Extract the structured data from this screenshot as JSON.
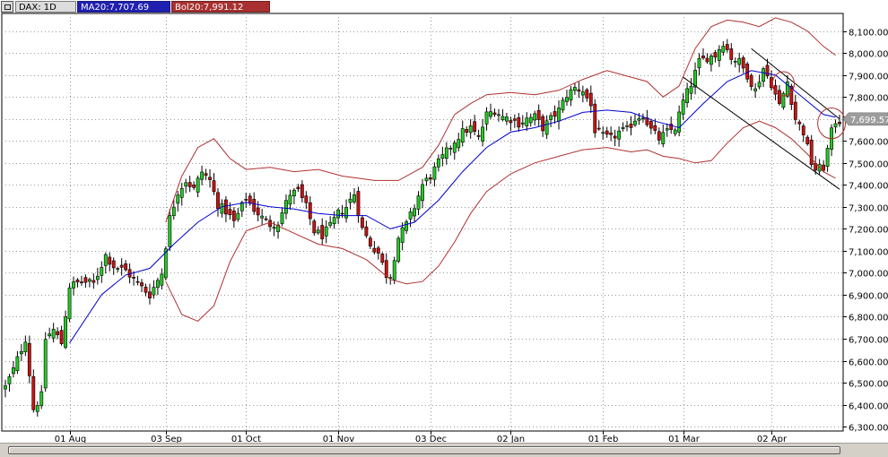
{
  "legend": {
    "symbol": "DAX: 1D",
    "ma": "MA20:7,707.69",
    "bol": "Bol20:7,991.12"
  },
  "colors": {
    "up_candle": "#22cc22",
    "down_candle": "#cc1111",
    "ma_line": "#0000cc",
    "bollinger": "#b03030",
    "trendline": "#000000",
    "grid": "#999999",
    "price_tag_bg": "#9c9c9c"
  },
  "chart_data": {
    "type": "candlestick",
    "title": "",
    "instrument": "DAX: 1D",
    "ylim": [
      6280,
      8180
    ],
    "y_ticks": [
      6300,
      6400,
      6500,
      6600,
      6700,
      6800,
      6900,
      7000,
      7100,
      7200,
      7300,
      7400,
      7500,
      7600,
      7700,
      7800,
      7900,
      8000,
      8100
    ],
    "y_tick_labels": [
      "6,300.00",
      "6,400.00",
      "6,500.00",
      "6,600.00",
      "6,700.00",
      "6,800.00",
      "6,900.00",
      "7,000.00",
      "7,100.00",
      "7,200.00",
      "7,300.00",
      "7,400.00",
      "7,500.00",
      "7,600.00",
      "7,700.00",
      "7,800.00",
      "7,900.00",
      "8,000.00",
      "8,100.00"
    ],
    "x_labels": [
      {
        "label": "01 Aug",
        "index": 16
      },
      {
        "label": "03 Sep",
        "index": 40
      },
      {
        "label": "01 Oct",
        "index": 60
      },
      {
        "label": "01 Nov",
        "index": 83
      },
      {
        "label": "03 Dec",
        "index": 106
      },
      {
        "label": "02 Jan",
        "index": 126
      },
      {
        "label": "01 Feb",
        "index": 149
      },
      {
        "label": "01 Mar",
        "index": 169
      },
      {
        "label": "02 Apr",
        "index": 191
      }
    ],
    "last_price": 7699.57,
    "last_price_label": "7,699.57",
    "grid": true,
    "anchors": [
      [
        0,
        6480
      ],
      [
        2,
        6560
      ],
      [
        5,
        6700
      ],
      [
        7,
        6380
      ],
      [
        9,
        6440
      ],
      [
        10,
        6700
      ],
      [
        12,
        6740
      ],
      [
        14,
        6680
      ],
      [
        16,
        6940
      ],
      [
        19,
        6960
      ],
      [
        22,
        6950
      ],
      [
        25,
        7080
      ],
      [
        27,
        7030
      ],
      [
        30,
        7010
      ],
      [
        33,
        6950
      ],
      [
        36,
        6900
      ],
      [
        39,
        7000
      ],
      [
        41,
        7250
      ],
      [
        43,
        7370
      ],
      [
        45,
        7420
      ],
      [
        47,
        7380
      ],
      [
        49,
        7460
      ],
      [
        51,
        7420
      ],
      [
        53,
        7310
      ],
      [
        55,
        7280
      ],
      [
        57,
        7230
      ],
      [
        60,
        7340
      ],
      [
        62,
        7290
      ],
      [
        64,
        7250
      ],
      [
        66,
        7220
      ],
      [
        68,
        7230
      ],
      [
        71,
        7360
      ],
      [
        73,
        7370
      ],
      [
        75,
        7300
      ],
      [
        77,
        7190
      ],
      [
        79,
        7170
      ],
      [
        81,
        7210
      ],
      [
        83,
        7270
      ],
      [
        85,
        7300
      ],
      [
        87,
        7360
      ],
      [
        89,
        7200
      ],
      [
        91,
        7130
      ],
      [
        93,
        7090
      ],
      [
        95,
        6990
      ],
      [
        96,
        6990
      ],
      [
        98,
        7160
      ],
      [
        100,
        7220
      ],
      [
        102,
        7300
      ],
      [
        104,
        7400
      ],
      [
        106,
        7440
      ],
      [
        108,
        7500
      ],
      [
        110,
        7550
      ],
      [
        112,
        7600
      ],
      [
        114,
        7640
      ],
      [
        116,
        7660
      ],
      [
        118,
        7610
      ],
      [
        120,
        7720
      ],
      [
        122,
        7740
      ],
      [
        124,
        7710
      ],
      [
        126,
        7700
      ],
      [
        128,
        7680
      ],
      [
        130,
        7700
      ],
      [
        132,
        7710
      ],
      [
        134,
        7660
      ],
      [
        136,
        7700
      ],
      [
        138,
        7740
      ],
      [
        140,
        7810
      ],
      [
        142,
        7840
      ],
      [
        144,
        7830
      ],
      [
        146,
        7760
      ],
      [
        147,
        7650
      ],
      [
        149,
        7620
      ],
      [
        151,
        7610
      ],
      [
        153,
        7640
      ],
      [
        155,
        7650
      ],
      [
        157,
        7700
      ],
      [
        159,
        7720
      ],
      [
        161,
        7650
      ],
      [
        163,
        7610
      ],
      [
        165,
        7640
      ],
      [
        167,
        7660
      ],
      [
        169,
        7780
      ],
      [
        171,
        7860
      ],
      [
        173,
        7960
      ],
      [
        175,
        7980
      ],
      [
        177,
        7990
      ],
      [
        179,
        8050
      ],
      [
        181,
        7980
      ],
      [
        183,
        7960
      ],
      [
        185,
        7900
      ],
      [
        187,
        7830
      ],
      [
        189,
        7930
      ],
      [
        191,
        7860
      ],
      [
        193,
        7760
      ],
      [
        195,
        7870
      ],
      [
        197,
        7700
      ],
      [
        199,
        7640
      ],
      [
        201,
        7500
      ],
      [
        202,
        7470
      ],
      [
        204,
        7480
      ],
      [
        206,
        7640
      ],
      [
        207,
        7690
      ]
    ],
    "ma20": [
      [
        16,
        6680
      ],
      [
        24,
        6900
      ],
      [
        30,
        6990
      ],
      [
        36,
        7020
      ],
      [
        42,
        7130
      ],
      [
        48,
        7230
      ],
      [
        54,
        7300
      ],
      [
        60,
        7320
      ],
      [
        66,
        7300
      ],
      [
        72,
        7290
      ],
      [
        78,
        7270
      ],
      [
        84,
        7260
      ],
      [
        90,
        7260
      ],
      [
        96,
        7200
      ],
      [
        102,
        7230
      ],
      [
        108,
        7330
      ],
      [
        114,
        7460
      ],
      [
        120,
        7570
      ],
      [
        126,
        7640
      ],
      [
        132,
        7660
      ],
      [
        138,
        7690
      ],
      [
        144,
        7730
      ],
      [
        150,
        7740
      ],
      [
        156,
        7730
      ],
      [
        162,
        7690
      ],
      [
        168,
        7660
      ],
      [
        174,
        7770
      ],
      [
        180,
        7870
      ],
      [
        186,
        7920
      ],
      [
        192,
        7900
      ],
      [
        198,
        7810
      ],
      [
        204,
        7720
      ],
      [
        207,
        7708
      ]
    ],
    "bollinger_upper": [
      [
        40,
        7230
      ],
      [
        44,
        7440
      ],
      [
        48,
        7570
      ],
      [
        52,
        7610
      ],
      [
        56,
        7520
      ],
      [
        60,
        7470
      ],
      [
        66,
        7480
      ],
      [
        72,
        7460
      ],
      [
        78,
        7470
      ],
      [
        84,
        7440
      ],
      [
        88,
        7430
      ],
      [
        92,
        7420
      ],
      [
        98,
        7420
      ],
      [
        104,
        7480
      ],
      [
        108,
        7580
      ],
      [
        112,
        7720
      ],
      [
        116,
        7770
      ],
      [
        120,
        7810
      ],
      [
        126,
        7820
      ],
      [
        132,
        7810
      ],
      [
        138,
        7830
      ],
      [
        144,
        7880
      ],
      [
        150,
        7920
      ],
      [
        156,
        7890
      ],
      [
        160,
        7870
      ],
      [
        164,
        7800
      ],
      [
        168,
        7850
      ],
      [
        172,
        8020
      ],
      [
        176,
        8120
      ],
      [
        180,
        8150
      ],
      [
        184,
        8140
      ],
      [
        188,
        8120
      ],
      [
        192,
        8160
      ],
      [
        196,
        8140
      ],
      [
        200,
        8100
      ],
      [
        204,
        8030
      ],
      [
        207,
        7990
      ]
    ],
    "bollinger_lower": [
      [
        40,
        6960
      ],
      [
        44,
        6810
      ],
      [
        48,
        6780
      ],
      [
        52,
        6850
      ],
      [
        56,
        7050
      ],
      [
        60,
        7190
      ],
      [
        66,
        7230
      ],
      [
        72,
        7180
      ],
      [
        78,
        7130
      ],
      [
        84,
        7110
      ],
      [
        90,
        7060
      ],
      [
        96,
        6970
      ],
      [
        100,
        6950
      ],
      [
        104,
        6960
      ],
      [
        108,
        7030
      ],
      [
        112,
        7140
      ],
      [
        116,
        7270
      ],
      [
        120,
        7370
      ],
      [
        126,
        7450
      ],
      [
        132,
        7500
      ],
      [
        138,
        7530
      ],
      [
        144,
        7560
      ],
      [
        150,
        7570
      ],
      [
        156,
        7550
      ],
      [
        160,
        7560
      ],
      [
        164,
        7530
      ],
      [
        168,
        7520
      ],
      [
        172,
        7500
      ],
      [
        176,
        7510
      ],
      [
        180,
        7590
      ],
      [
        184,
        7660
      ],
      [
        188,
        7690
      ],
      [
        192,
        7660
      ],
      [
        196,
        7610
      ],
      [
        200,
        7540
      ],
      [
        204,
        7460
      ],
      [
        207,
        7430
      ]
    ],
    "trend_channel": [
      {
        "from": [
          169,
          7890
        ],
        "to": [
          208,
          7380
        ]
      },
      {
        "from": [
          186,
          8020
        ],
        "to": [
          208,
          7700
        ]
      }
    ],
    "circles": [
      {
        "center": [
          194,
          7860
        ],
        "radius_data": 55
      },
      {
        "center": [
          206,
          7680
        ],
        "radius_data": 70
      }
    ]
  }
}
